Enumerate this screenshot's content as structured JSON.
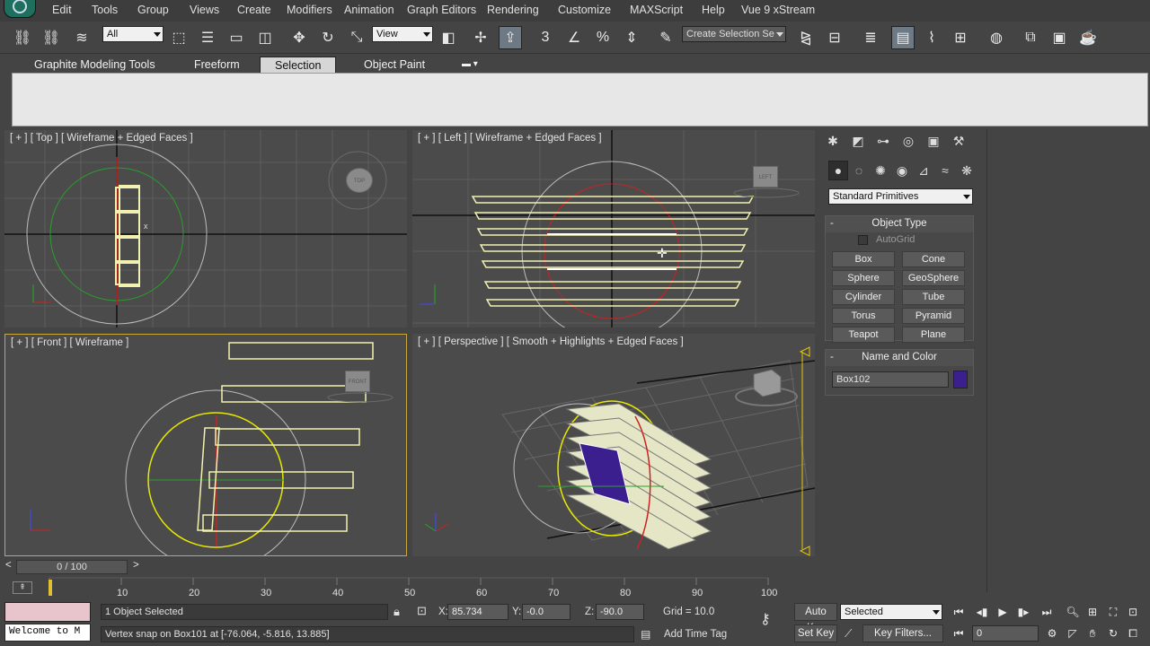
{
  "menu": {
    "items": [
      "Edit",
      "Tools",
      "Group",
      "Views",
      "Create",
      "Modifiers",
      "Animation",
      "Graph Editors",
      "Rendering",
      "Customize",
      "MAXScript",
      "Help",
      "Vue 9 xStream"
    ]
  },
  "toolbar": {
    "selection_filter": "All",
    "reference_coord": "View",
    "named_selection_placeholder": "Create Selection Se"
  },
  "ribbon": {
    "tabs": [
      "Graphite Modeling Tools",
      "Freeform",
      "Selection",
      "Object Paint"
    ],
    "selected_tab": "Selection"
  },
  "viewports": {
    "top": {
      "label": "[ + ] [ Top ] [ Wireframe + Edged Faces ]",
      "cube": "TOP"
    },
    "left": {
      "label": "[ + ] [ Left ] [ Wireframe + Edged Faces ]",
      "cube": "LEFT"
    },
    "front": {
      "label": "[ + ] [ Front ] [ Wireframe ]",
      "cube": "FRONT"
    },
    "perspective": {
      "label": "[ + ] [ Perspective ] [ Smooth + Highlights + Edged Faces ]"
    }
  },
  "command_panel": {
    "category": "Standard Primitives",
    "object_type_title": "Object Type",
    "autogrid": "AutoGrid",
    "primitives": [
      "Box",
      "Cone",
      "Sphere",
      "GeoSphere",
      "Cylinder",
      "Tube",
      "Torus",
      "Pyramid",
      "Teapot",
      "Plane"
    ],
    "name_color_title": "Name and Color",
    "object_name": "Box102",
    "object_color": "#3b1f8f"
  },
  "timeline": {
    "frame_display": "0 / 100",
    "ticks": [
      "10",
      "20",
      "30",
      "40",
      "50",
      "60",
      "70",
      "80",
      "90",
      "100"
    ]
  },
  "status": {
    "maxscript_listener": "Welcome to M",
    "selection_info": "1 Object Selected",
    "prompt": "Vertex snap on Box101 at [-76.064, -5.816, 13.885]",
    "x_label": "X:",
    "x_value": "85.734",
    "y_label": "Y:",
    "y_value": "-0.0",
    "z_label": "Z:",
    "z_value": "-90.0",
    "grid": "Grid = 10.0",
    "add_time_tag": "Add Time Tag",
    "auto_key": "Auto Key",
    "set_key": "Set Key",
    "key_mode": "Selected",
    "key_filters": "Key Filters...",
    "current_frame": "0"
  },
  "colors": {
    "viewport_bg": "#4b4b4b",
    "selected_wire": "#f2f2b0",
    "active_border": "#c8a83c"
  }
}
